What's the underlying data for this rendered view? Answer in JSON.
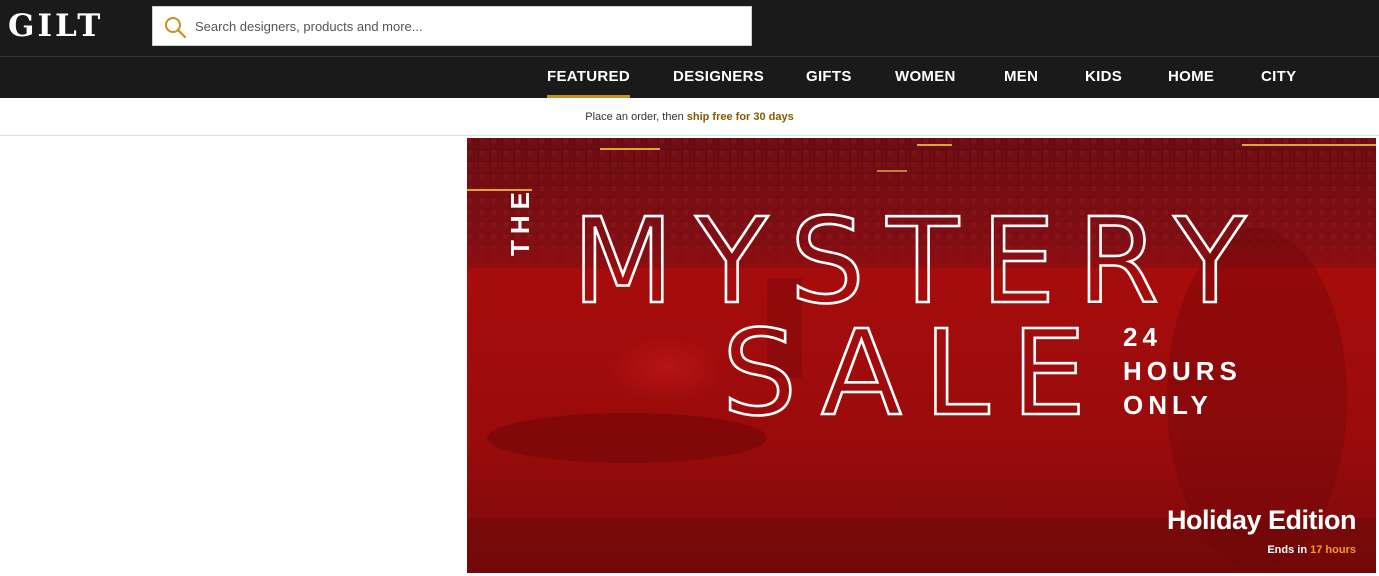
{
  "header": {
    "logo": "GILT",
    "search_placeholder": "Search designers, products and more..."
  },
  "nav": {
    "items": [
      "FEATURED",
      "DESIGNERS",
      "GIFTS",
      "WOMEN",
      "MEN",
      "KIDS",
      "HOME",
      "CITY"
    ],
    "active": "FEATURED"
  },
  "promo": {
    "prefix": "Place an order, then",
    "link": "ship free for 30 days"
  },
  "hero": {
    "the": "THE",
    "line1": "MYSTERY",
    "line2": "SALE",
    "hours_1": "24",
    "hours_2": "HOURS",
    "hours_3": "ONLY",
    "edition": "Holiday Edition",
    "ends_prefix": "Ends in",
    "ends_value": "17 hours"
  },
  "colors": {
    "header_bg": "#1a1a1a",
    "accent_gold": "#c8901e",
    "promo_link": "#8a5a00",
    "hero_red": "#9b0a0a",
    "countdown": "#f0a020"
  },
  "icons": {
    "search": "search-icon"
  }
}
